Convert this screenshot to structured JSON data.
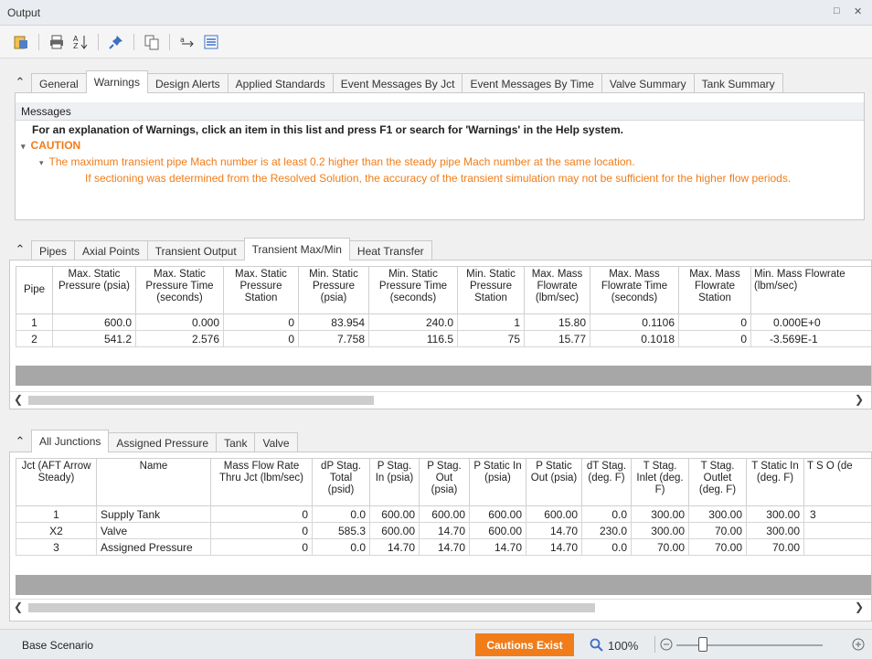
{
  "window": {
    "title": "Output",
    "controls": [
      "□",
      "✕"
    ]
  },
  "toolbar": {
    "icons": [
      "report-icon",
      "print-icon",
      "sort-az-icon",
      "pin-icon",
      "copy-icon",
      "arrange-icon",
      "list-icon"
    ]
  },
  "top_tabs": [
    "General",
    "Warnings",
    "Design Alerts",
    "Applied Standards",
    "Event Messages By Jct",
    "Event Messages By Time",
    "Valve Summary",
    "Tank Summary"
  ],
  "messages": {
    "header": "Messages",
    "intro": "For an explanation of Warnings, click an item in this list and press F1 or search for 'Warnings' in the Help system.",
    "caution_label": "CAUTION",
    "caution_line1": "The maximum transient pipe Mach number is at least 0.2 higher than the steady pipe Mach number at the same location.",
    "caution_line2": "If sectioning was determined from the Resolved Solution, the accuracy of the transient simulation may not be sufficient for the higher flow periods."
  },
  "pipe_tabs": [
    "Pipes",
    "Axial Points",
    "Transient Output",
    "Transient Max/Min",
    "Heat Transfer"
  ],
  "pipe_table": {
    "columns": [
      "Pipe",
      "Max. Static Pressure (psia)",
      "Max. Static Pressure Time (seconds)",
      "Max. Static Pressure Station",
      "Min. Static Pressure (psia)",
      "Min. Static Pressure Time (seconds)",
      "Min. Static Pressure Station",
      "Max. Mass Flowrate (lbm/sec)",
      "Max. Mass Flowrate Time (seconds)",
      "Max. Mass Flowrate Station",
      "Min. Mass Flowrate (lbm/sec)"
    ],
    "rows": [
      [
        "1",
        "600.0",
        "0.000",
        "0",
        "83.954",
        "240.0",
        "1",
        "15.80",
        "0.1106",
        "0",
        "0.000E+0"
      ],
      [
        "2",
        "541.2",
        "2.576",
        "0",
        "7.758",
        "116.5",
        "75",
        "15.77",
        "0.1018",
        "0",
        "-3.569E-1"
      ]
    ]
  },
  "junction_tabs": [
    "All Junctions",
    "Assigned Pressure",
    "Tank",
    "Valve"
  ],
  "junction_table": {
    "columns": [
      "Jct (AFT Arrow Steady)",
      "Name",
      "Mass Flow Rate Thru Jct (lbm/sec)",
      "dP Stag. Total (psid)",
      "P Stag. In (psia)",
      "P Stag. Out (psia)",
      "P Static In (psia)",
      "P Static Out (psia)",
      "dT Stag. (deg. F)",
      "T Stag. Inlet (deg. F)",
      "T Stag. Outlet (deg. F)",
      "T Static In (deg. F)",
      "T S O (de"
    ],
    "rows": [
      [
        "1",
        "Supply Tank",
        "0",
        "0.0",
        "600.00",
        "600.00",
        "600.00",
        "600.00",
        "0.0",
        "300.00",
        "300.00",
        "300.00",
        "3"
      ],
      [
        "X2",
        "Valve",
        "0",
        "585.3",
        "600.00",
        "14.70",
        "600.00",
        "14.70",
        "230.0",
        "300.00",
        "70.00",
        "300.00",
        ""
      ],
      [
        "3",
        "Assigned Pressure",
        "0",
        "0.0",
        "14.70",
        "14.70",
        "14.70",
        "14.70",
        "0.0",
        "70.00",
        "70.00",
        "70.00",
        ""
      ]
    ]
  },
  "status": {
    "scenario": "Base Scenario",
    "cautions": "Cautions Exist",
    "zoom": "100%"
  },
  "colors": {
    "accent": "#f07d1a",
    "selected_tab_bg": "#ffffff"
  }
}
